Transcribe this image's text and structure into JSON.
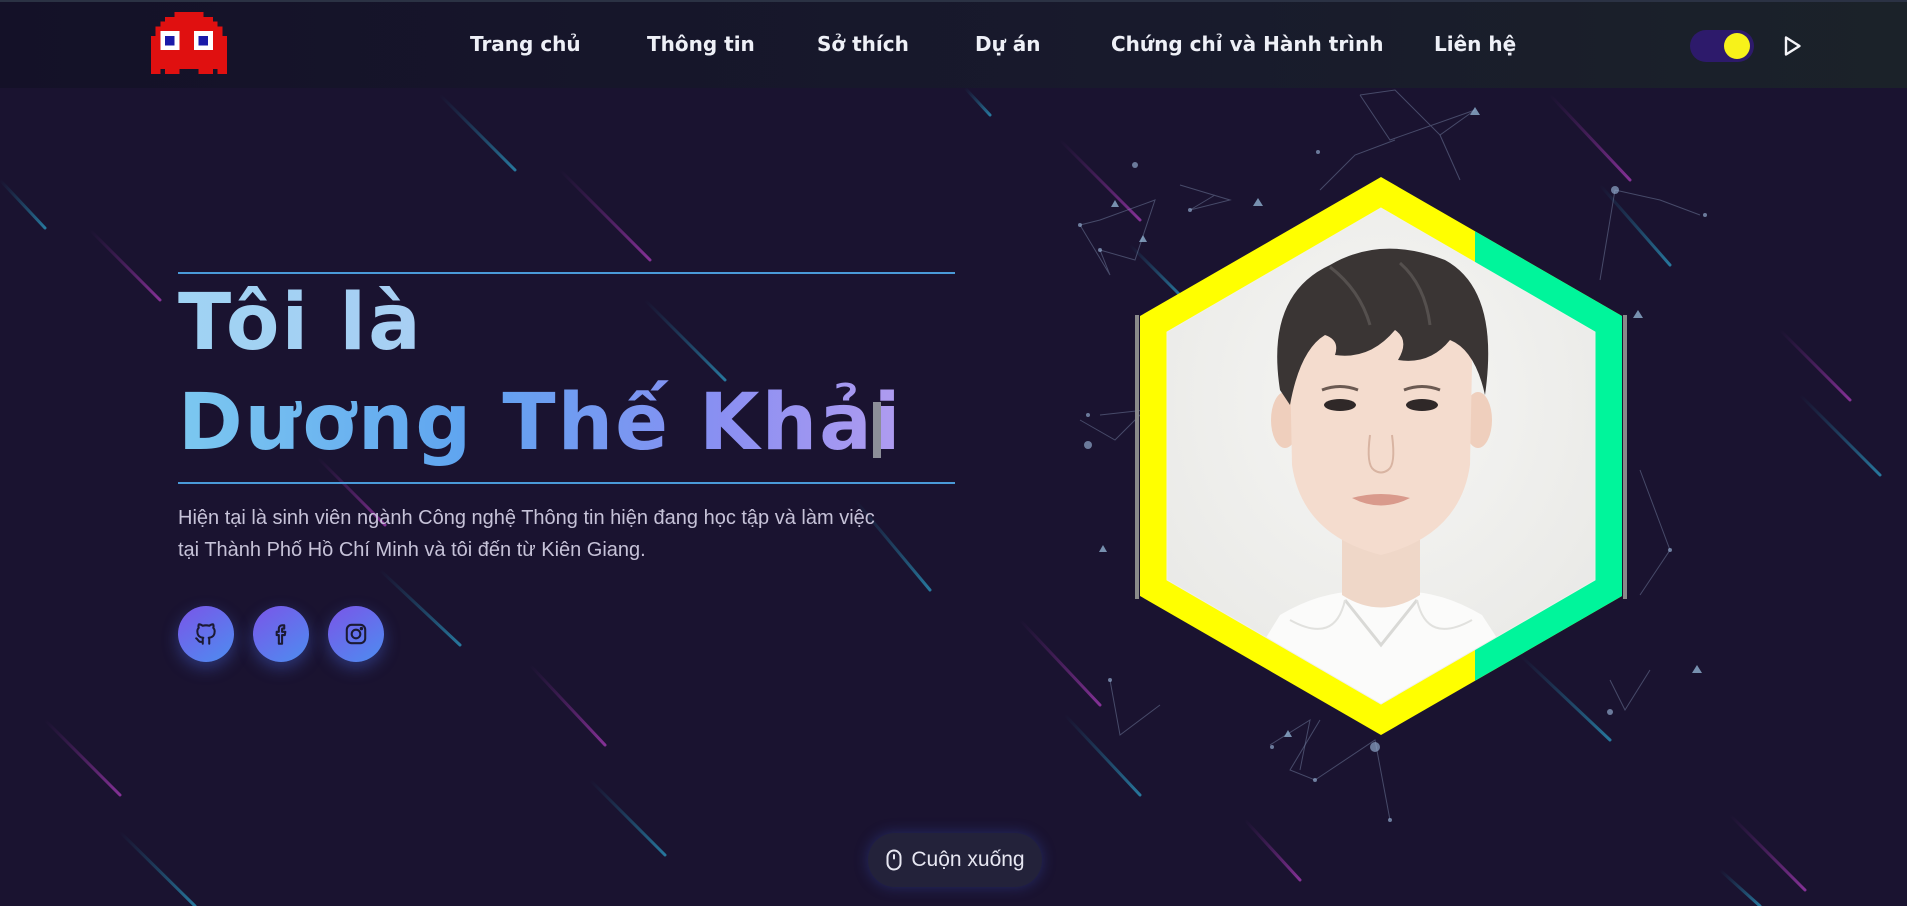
{
  "nav": {
    "logo_icon": "pixel-ghost-icon",
    "links": [
      "Trang chủ",
      "Thông tin",
      "Sở thích",
      "Dự án",
      "Chứng chỉ và Hành trình",
      "Liên hệ"
    ],
    "theme_toggle_icon": "theme-toggle-icon",
    "play_icon": "play-icon"
  },
  "hero": {
    "title_line1": "Tôi là",
    "title_line2": "Dương Thế Khải",
    "description_line1": "Hiện tại là sinh viên ngành Công nghệ Thông tin hiện đang học tập và làm việc",
    "description_line2": "tại Thành Phố Hồ Chí Minh và tôi đến từ Kiên Giang.",
    "socials": [
      "github-icon",
      "facebook-icon",
      "instagram-icon"
    ]
  },
  "portrait": {
    "frame_colors": [
      "#ffff00",
      "#00f59b"
    ]
  },
  "scroll": {
    "label": "Cuộn xuống",
    "icon": "mouse-icon"
  },
  "colors": {
    "background": "#1a1330",
    "accent_blue": "#4a9ad8",
    "toggle_knob": "#f7f21a"
  }
}
